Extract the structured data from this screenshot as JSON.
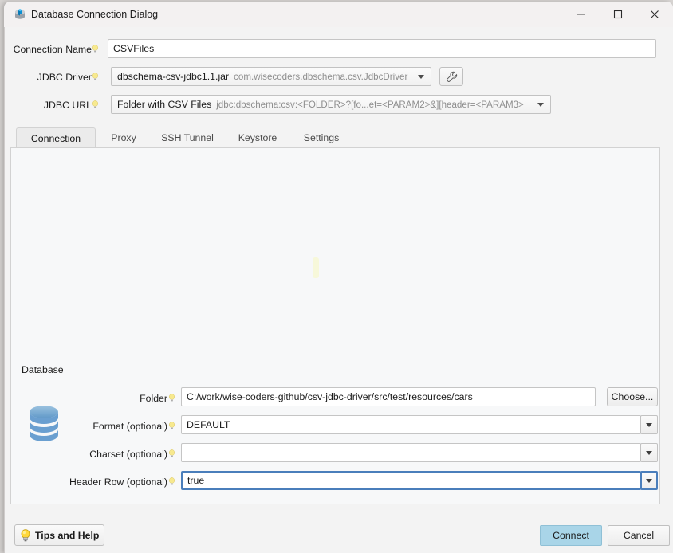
{
  "window": {
    "title": "Database Connection Dialog",
    "icon": "database-dialog-icon",
    "controls": {
      "minimize": "minimize-icon",
      "maximize": "maximize-icon",
      "close": "close-icon"
    }
  },
  "form": {
    "connection_name": {
      "label": "Connection Name",
      "value": "CSVFiles",
      "placeholder": ""
    },
    "jdbc_driver": {
      "label": "JDBC Driver",
      "value": "dbschema-csv-jdbc1.1.jar",
      "sub_value": "com.wisecoders.dbschema.csv.JdbcDriver",
      "edit_button": "wrench-icon"
    },
    "jdbc_url": {
      "label": "JDBC URL",
      "value": "Folder with CSV Files",
      "sub_value": "jdbc:dbschema:csv:<FOLDER>?[fo...et=<PARAM2>&][header=<PARAM3>"
    }
  },
  "tabs": [
    {
      "label": "Connection",
      "active": true
    },
    {
      "label": "Proxy",
      "active": false
    },
    {
      "label": "SSH Tunnel",
      "active": false
    },
    {
      "label": "Keystore",
      "active": false
    },
    {
      "label": "Settings",
      "active": false
    }
  ],
  "database_group": {
    "legend": "Database",
    "icon": "database-stack-icon",
    "fields": {
      "folder": {
        "label": "Folder",
        "value": "C:/work/wise-coders-github/csv-jdbc-driver/src/test/resources/cars",
        "choose_label": "Choose..."
      },
      "format": {
        "label": "Format (optional)",
        "value": "DEFAULT"
      },
      "charset": {
        "label": "Charset (optional)",
        "value": ""
      },
      "header_row": {
        "label": "Header Row (optional)",
        "value": "true"
      }
    }
  },
  "footer": {
    "tips_label": "Tips and Help",
    "tips_icon": "lightbulb-icon",
    "connect_label": "Connect",
    "cancel_label": "Cancel"
  },
  "colors": {
    "accent_button": "#a9d5e8",
    "focus_border": "#4a7ebb",
    "database_icon": "#6fa8d2",
    "hint_bulb": "#f3de6e"
  }
}
